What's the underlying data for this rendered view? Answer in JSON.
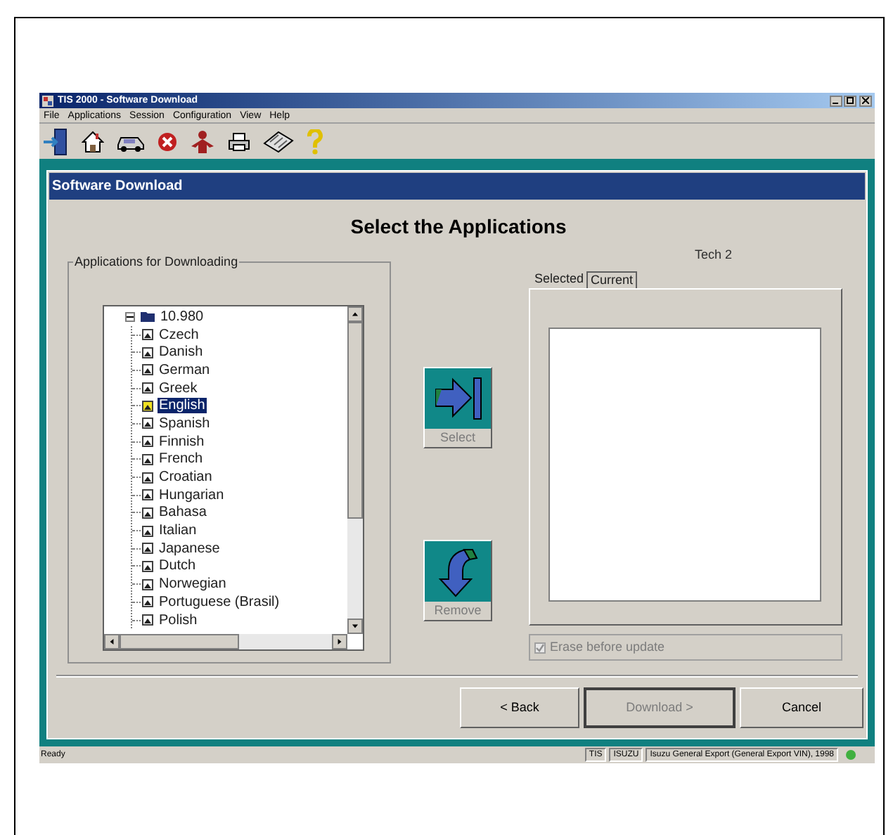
{
  "window": {
    "title": "TIS 2000 - Software Download"
  },
  "menu": [
    "File",
    "Applications",
    "Session",
    "Configuration",
    "View",
    "Help"
  ],
  "panel": {
    "title": "Software Download",
    "heading": "Select the Applications"
  },
  "tree": {
    "group_label": "Applications for Downloading",
    "root": {
      "label": "10.980",
      "expanded": true,
      "children": [
        {
          "label": "Czech",
          "selected": false
        },
        {
          "label": "Danish",
          "selected": false
        },
        {
          "label": "German",
          "selected": false
        },
        {
          "label": "Greek",
          "selected": false
        },
        {
          "label": "English",
          "selected": true
        },
        {
          "label": "Spanish",
          "selected": false
        },
        {
          "label": "Finnish",
          "selected": false
        },
        {
          "label": "French",
          "selected": false
        },
        {
          "label": "Croatian",
          "selected": false
        },
        {
          "label": "Hungarian",
          "selected": false
        },
        {
          "label": "Bahasa",
          "selected": false
        },
        {
          "label": "Italian",
          "selected": false
        },
        {
          "label": "Japanese",
          "selected": false
        },
        {
          "label": "Dutch",
          "selected": false
        },
        {
          "label": "Norwegian",
          "selected": false
        },
        {
          "label": "Portuguese (Brasil)",
          "selected": false
        },
        {
          "label": "Polish",
          "selected": false
        }
      ]
    }
  },
  "move_buttons": [
    {
      "kind": "select",
      "label": "Select",
      "disabled": true
    },
    {
      "kind": "remove",
      "label": "Remove",
      "disabled": true
    }
  ],
  "device_label": "Tech 2",
  "tabs": [
    {
      "label": "Selected",
      "selected": true
    },
    {
      "label": "Current",
      "selected": false
    }
  ],
  "erase_checkbox": {
    "label": "Erase before update",
    "checked": true,
    "disabled": true
  },
  "nav_buttons": [
    {
      "label": "< Back",
      "disabled": false,
      "default": false
    },
    {
      "label": "Download >",
      "disabled": true,
      "default": true
    },
    {
      "label": "Cancel",
      "disabled": false,
      "default": false
    }
  ],
  "status_bar": {
    "message": "Ready",
    "panes": [
      "TIS",
      "ISUZU",
      "Isuzu General Export (General Export VIN), 1998"
    ]
  }
}
